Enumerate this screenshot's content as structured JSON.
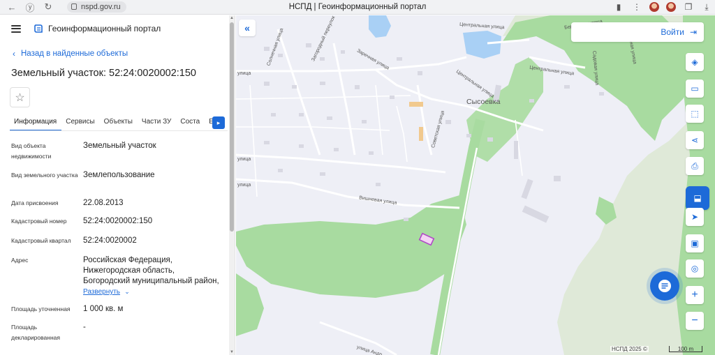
{
  "browser": {
    "url": "nspd.gov.ru",
    "tab_title": "НСПД | Геоинформационный портал"
  },
  "header": {
    "app_title": "Геоинформационный портал"
  },
  "back_link": "Назад в найденные объекты",
  "page_title": "Земельный участок: 52:24:0020002:150",
  "tabs": [
    "Информация",
    "Сервисы",
    "Объекты",
    "Части ЗУ",
    "Соста",
    "Е"
  ],
  "info": [
    {
      "label": "Вид объекта недвижимости",
      "value": "Земельный участок"
    },
    {
      "label": "Вид земельного участка",
      "value": "Землепользование"
    },
    {
      "label": "Дата присвоения",
      "value": "22.08.2013"
    },
    {
      "label": "Кадастровый номер",
      "value": "52:24:0020002:150"
    },
    {
      "label": "Кадастровый квартал",
      "value": "52:24:0020002"
    },
    {
      "label": "Адрес",
      "value_lines": [
        "Российская Федерация,",
        "Нижегородская область,",
        "Богородский муниципальный район,"
      ],
      "expand": "Развернуть"
    },
    {
      "label": "Площадь уточненная",
      "value": "1 000 кв. м"
    },
    {
      "label": "Площадь декларированная",
      "value": "-"
    }
  ],
  "map": {
    "login": "Войти",
    "village": "Сысоевка",
    "streets": [
      "Центральная улица",
      "Центральная улица",
      "Центральная улица",
      "Северная улица",
      "Садовая улица",
      "Советская улица",
      "Заречная улица",
      "Загородный переулок",
      "Солнечная улица",
      "Вишневая улица",
      "улица",
      "улица",
      "улица",
      "улица Андр",
      "Береговая улица"
    ],
    "copyright": "НСПД 2025 ©",
    "scale": "100 m"
  },
  "colors": {
    "accent": "#1d6ad8",
    "forest": "#a8dba0",
    "water": "#a9d0f5",
    "parcel": "#b04ac6"
  }
}
